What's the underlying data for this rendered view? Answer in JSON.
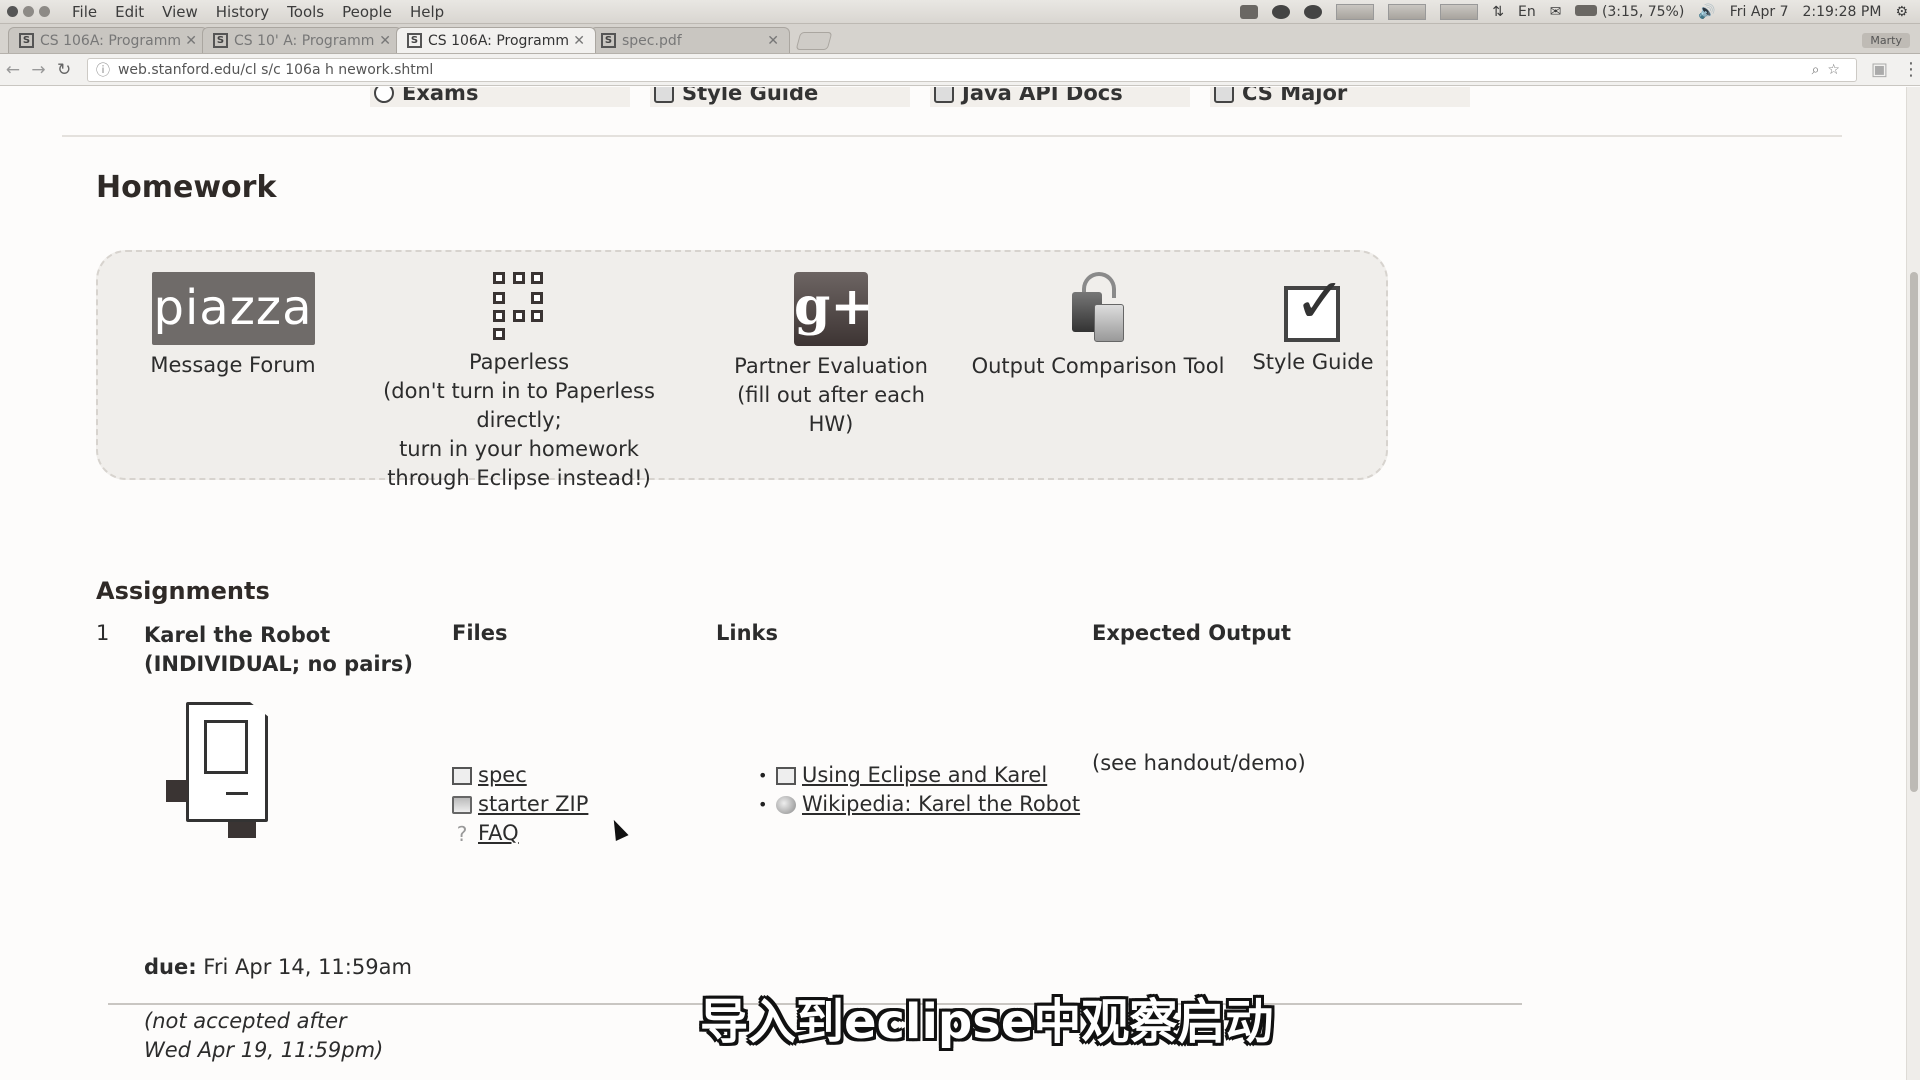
{
  "system": {
    "menus": [
      "File",
      "Edit",
      "View",
      "History",
      "Tools",
      "People",
      "Help"
    ],
    "battery": "(3:15, 75%)",
    "date": "Fri Apr 7",
    "time": "2:19:28 PM",
    "keyboard": "En"
  },
  "tabs": [
    {
      "label": "CS 106A: Programm",
      "favicon": "S"
    },
    {
      "label": "CS 10'  A: Programm",
      "favicon": "S"
    },
    {
      "label": "CS 106A: Programm",
      "favicon": "S"
    },
    {
      "label": "spec.pdf",
      "favicon": "S"
    }
  ],
  "profile": "Marty",
  "address": {
    "url": "web.stanford.edu/cl  s/c 106a  h  nework.shtml"
  },
  "topnav": [
    "Exams",
    "Style Guide",
    "Java API Docs",
    "CS Major"
  ],
  "homework": {
    "heading": "Homework",
    "tools": [
      {
        "logo_text": "piazza",
        "label": "Message Forum"
      },
      {
        "label": "Paperless",
        "note1": "(don't turn in to Paperless directly;",
        "note2": "turn in your homework",
        "note3": "through Eclipse instead!)"
      },
      {
        "logo_text": "g+",
        "label": "Partner Evaluation",
        "note1": "(fill out after each HW)"
      },
      {
        "label": "Output Comparison Tool"
      },
      {
        "label": "Style Guide"
      }
    ]
  },
  "assignments": {
    "heading": "Assignments",
    "columns": {
      "files": "Files",
      "links": "Links",
      "expected": "Expected Output"
    },
    "items": [
      {
        "number": "1",
        "title_line1": "Karel the Robot",
        "title_line2": "(INDIVIDUAL; no pairs)",
        "due_label": "due:",
        "due_value": " Fri Apr 14, 11:59am",
        "note_line1": "(not accepted after",
        "note_line2": "Wed Apr 19, 11:59pm)",
        "files": [
          "spec",
          "starter ZIP",
          "FAQ"
        ],
        "links": [
          "Using Eclipse and Karel",
          "Wikipedia: Karel the Robot"
        ],
        "expected": "(see handout/demo)"
      }
    ]
  },
  "subtitle": "导入到eclipse中观察启动"
}
